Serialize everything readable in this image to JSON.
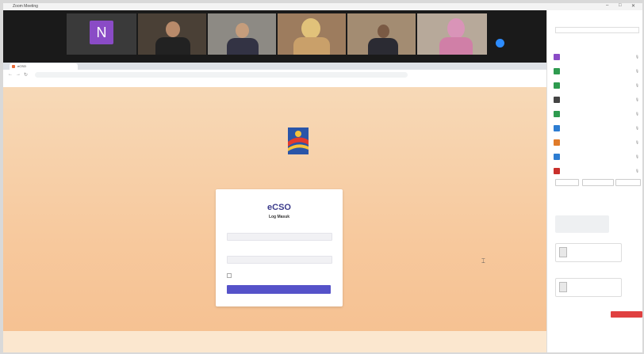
{
  "window": {
    "title": "Zoom Meeting",
    "controls": [
      "–",
      "□",
      "✕"
    ]
  },
  "video_strip": {
    "tiles": [
      {
        "initial": "N",
        "name": "",
        "avatar_color": "#8a4bc6"
      },
      {
        "name": ""
      },
      {
        "name": ""
      },
      {
        "name": ""
      },
      {
        "name": ""
      },
      {
        "name": ""
      }
    ]
  },
  "browser": {
    "tab_title": "eCSO",
    "address": "",
    "bookmarks": []
  },
  "page": {
    "logo_text": "",
    "logo_sub": "",
    "login": {
      "title": "eCSO",
      "subtitle": "Log Masuk",
      "email_label": "",
      "email_placeholder": "",
      "password_label": "",
      "password_placeholder": "",
      "show_label": "",
      "remember_label": "",
      "forgot_label": "",
      "submit_label": ""
    }
  },
  "sidebar": {
    "title": "",
    "search_placeholder": "",
    "participants": [
      {
        "name": "",
        "color": "#8a4bc6"
      },
      {
        "name": "",
        "color": "#2e9b4f"
      },
      {
        "name": "",
        "color": "#2e9b4f"
      },
      {
        "name": "",
        "color": "#444444"
      },
      {
        "name": "",
        "color": "#2e9b4f"
      },
      {
        "name": "",
        "color": "#2d7dd2"
      },
      {
        "name": "",
        "color": "#e07b2a"
      },
      {
        "name": "",
        "color": "#2d7dd2"
      },
      {
        "name": "",
        "color": "#c9302c"
      }
    ],
    "buttons": [
      "",
      "",
      ""
    ],
    "chat_title": "",
    "chat": {
      "msg1_from": "",
      "msg1_text": "",
      "msg2_from": "",
      "file1_name": "",
      "file1_size": "",
      "msg3_from": "",
      "file2_name": "",
      "file2_size": "",
      "msg4_from": "",
      "badge": "",
      "to_label": "",
      "message_placeholder": ""
    }
  }
}
